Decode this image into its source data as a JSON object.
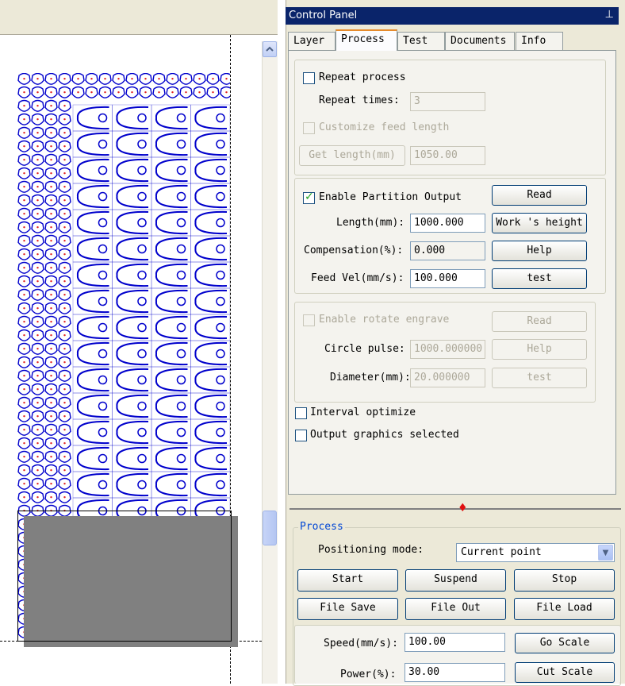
{
  "panel": {
    "title": "Control Panel",
    "pin_glyph": "⊥",
    "tabs": [
      "Layer",
      "Process",
      "Test",
      "Documents",
      "Info"
    ],
    "active_tab": "Process"
  },
  "process_tab": {
    "repeat_process": {
      "label": "Repeat process",
      "checked": false
    },
    "repeat_times": {
      "label": "Repeat times:",
      "value": "3"
    },
    "customize_feed": {
      "label": "Customize feed length",
      "checked": false
    },
    "get_length": {
      "button": "Get length(mm)",
      "value": "1050.00"
    },
    "partition": {
      "enable_label": "Enable Partition Output",
      "checked": true,
      "read_button": "Read",
      "length_label": "Length(mm):",
      "length_value": "1000.000",
      "work_height_button": "Work 's height",
      "compensation_label": "Compensation(%):",
      "compensation_value": "0.000",
      "help_button": "Help",
      "feed_vel_label": "Feed Vel(mm/s):",
      "feed_vel_value": "100.000",
      "test_button": "test"
    },
    "rotate": {
      "enable_label": "Enable rotate engrave",
      "checked": false,
      "read_button": "Read",
      "circle_pulse_label": "Circle pulse:",
      "circle_pulse_value": "1000.000000",
      "help_button": "Help",
      "diameter_label": "Diameter(mm):",
      "diameter_value": "20.000000",
      "test_button": "test"
    },
    "interval_optimize": {
      "label": "Interval optimize",
      "checked": false
    },
    "output_selected": {
      "label": "Output graphics selected",
      "checked": false
    }
  },
  "process_section": {
    "legend": "Process",
    "positioning_label": "Positioning mode:",
    "positioning_value": "Current point",
    "buttons_row1": [
      "Start",
      "Suspend",
      "Stop"
    ],
    "buttons_row2": [
      "File Save",
      "File Out",
      "File Load"
    ],
    "speed_label": "Speed(mm/s):",
    "speed_value": "100.00",
    "go_scale_button": "Go Scale",
    "power_label": "Power(%):",
    "power_value": "30.00",
    "cut_scale_button": "Cut Scale"
  },
  "colors": {
    "title_bar": "#0a246a",
    "pattern_stroke": "#0000cc",
    "pattern_dots": "#e02020",
    "active_tab_accent": "#e68b2c",
    "group_legend": "#0046d5"
  }
}
